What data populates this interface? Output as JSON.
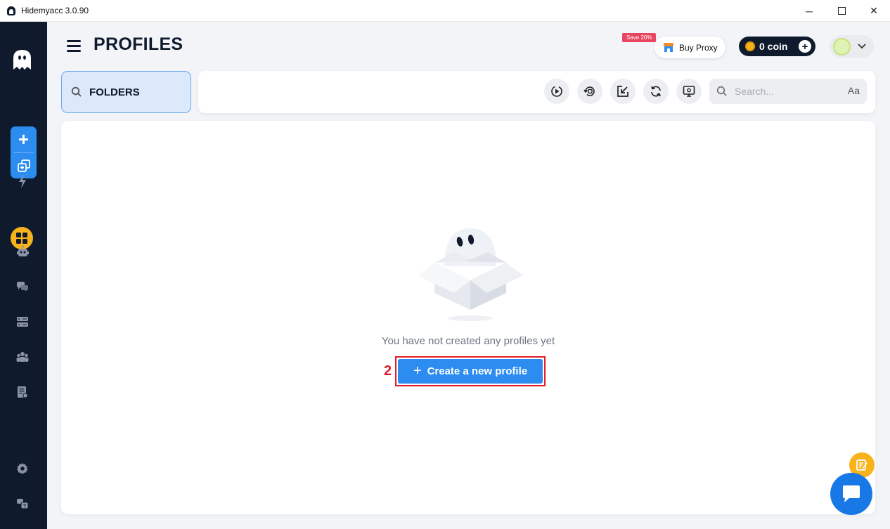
{
  "window": {
    "title": "Hidemyacc 3.0.90",
    "controls": {
      "minimize": "─",
      "maximize": "☐",
      "close": "✕"
    }
  },
  "sidebar": {
    "items": [
      {
        "icon": "ghost-logo-icon"
      },
      {
        "icon": "plus-icon",
        "label": "+"
      },
      {
        "icon": "copy-profile-icon"
      },
      {
        "icon": "lightning-icon"
      },
      {
        "icon": "grid-icon",
        "active": true
      },
      {
        "icon": "robot-icon"
      },
      {
        "icon": "chat-bubbles-icon"
      },
      {
        "icon": "server-icon"
      },
      {
        "icon": "team-icon"
      },
      {
        "icon": "document-icon"
      },
      {
        "icon": "gear-icon"
      },
      {
        "icon": "help-icon"
      }
    ]
  },
  "header": {
    "title": "PROFILES",
    "save_badge": "Save 20%",
    "buy_proxy": "Buy Proxy",
    "coin_label": "0 coin",
    "coin_add": "+"
  },
  "folders": {
    "label": "FOLDERS"
  },
  "toolbar": {
    "buttons": [
      "auto-start-icon",
      "restore-icon",
      "export-icon",
      "refresh-icon",
      "settings-screen-icon"
    ],
    "search_placeholder": "Search...",
    "case_toggle": "Aa"
  },
  "empty_state": {
    "message": "You have not created any profiles yet",
    "step_number": "2",
    "create_button": "Create a new profile",
    "create_plus": "+"
  },
  "colors": {
    "sidebar_bg": "#0f1b2d",
    "accent": "#2d8cf0",
    "active_yellow": "#f7b21c",
    "highlight_red": "#e11d2a"
  }
}
